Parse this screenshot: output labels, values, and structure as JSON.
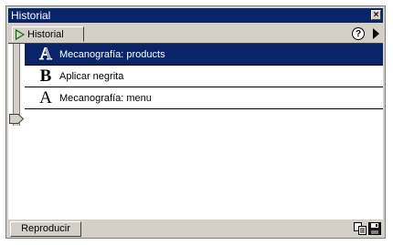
{
  "window": {
    "title": "Historial",
    "close_glyph": "×"
  },
  "tab": {
    "label": "Historial",
    "icon": "play-triangle-icon"
  },
  "toolbar": {
    "help_glyph": "?",
    "menu_icon": "panel-menu-arrow-icon"
  },
  "history": {
    "items": [
      {
        "glyph": "A",
        "icon": "typing-icon",
        "label": "Mecanografía: products",
        "selected": true
      },
      {
        "glyph": "B",
        "icon": "bold-icon",
        "label": "Aplicar negrita",
        "selected": false
      },
      {
        "glyph": "A",
        "icon": "typing-icon",
        "label": "Mecanografía: menu",
        "selected": false
      }
    ]
  },
  "footer": {
    "play_label": "Reproducir",
    "copy_icon": "copy-steps-icon",
    "save_icon": "save-command-icon"
  },
  "colors": {
    "selection": "#0a246a",
    "panel": "#d4d0c8",
    "titlebar": "#0a246a"
  }
}
